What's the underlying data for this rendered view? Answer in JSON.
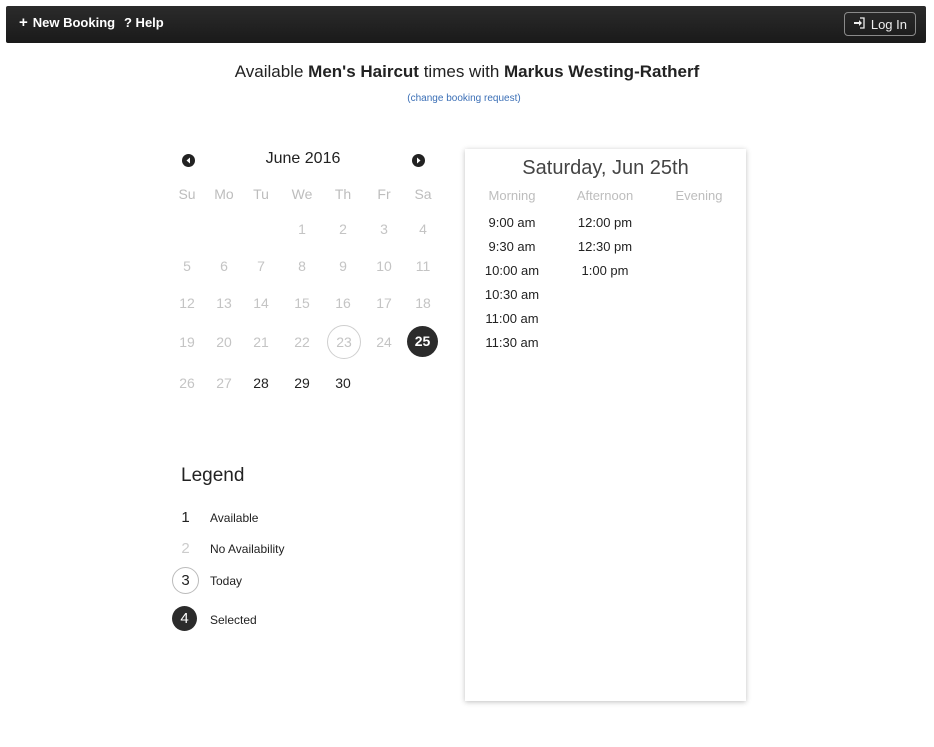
{
  "nav": {
    "new_booking": "New Booking",
    "help": "? Help",
    "login": "Log In"
  },
  "heading": {
    "prefix": "Available",
    "service": "Men's Haircut",
    "middle": "times with",
    "staff": "Markus Westing-Ratherf",
    "change_link": "(change booking request)"
  },
  "calendar": {
    "month_label": "June 2016",
    "weekdays": [
      "Su",
      "Mo",
      "Tu",
      "We",
      "Th",
      "Fr",
      "Sa"
    ],
    "weeks": [
      [
        "",
        "",
        "",
        "1",
        "2",
        "3",
        "4"
      ],
      [
        "5",
        "6",
        "7",
        "8",
        "9",
        "10",
        "11"
      ],
      [
        "12",
        "13",
        "14",
        "15",
        "16",
        "17",
        "18"
      ],
      [
        "19",
        "20",
        "21",
        "22",
        "23",
        "24",
        "25"
      ],
      [
        "26",
        "27",
        "28",
        "29",
        "30",
        "",
        ""
      ]
    ],
    "available_days": [
      "25",
      "28",
      "29",
      "30"
    ],
    "today": "23",
    "selected": "25"
  },
  "legend": {
    "title": "Legend",
    "items": [
      {
        "sample": "1",
        "label": "Available"
      },
      {
        "sample": "2",
        "label": "No Availability"
      },
      {
        "sample": "3",
        "label": "Today"
      },
      {
        "sample": "4",
        "label": "Selected"
      }
    ]
  },
  "times": {
    "date_label": "Saturday, Jun 25th",
    "columns": [
      {
        "name": "Morning",
        "slots": [
          "9:00 am",
          "9:30 am",
          "10:00 am",
          "10:30 am",
          "11:00 am",
          "11:30 am"
        ]
      },
      {
        "name": "Afternoon",
        "slots": [
          "12:00 pm",
          "12:30 pm",
          "1:00 pm"
        ]
      },
      {
        "name": "Evening",
        "slots": []
      }
    ]
  },
  "colors": {
    "navbar": "#1a1a1a",
    "link": "#3b6fb6",
    "selected": "#2b2b2b"
  }
}
